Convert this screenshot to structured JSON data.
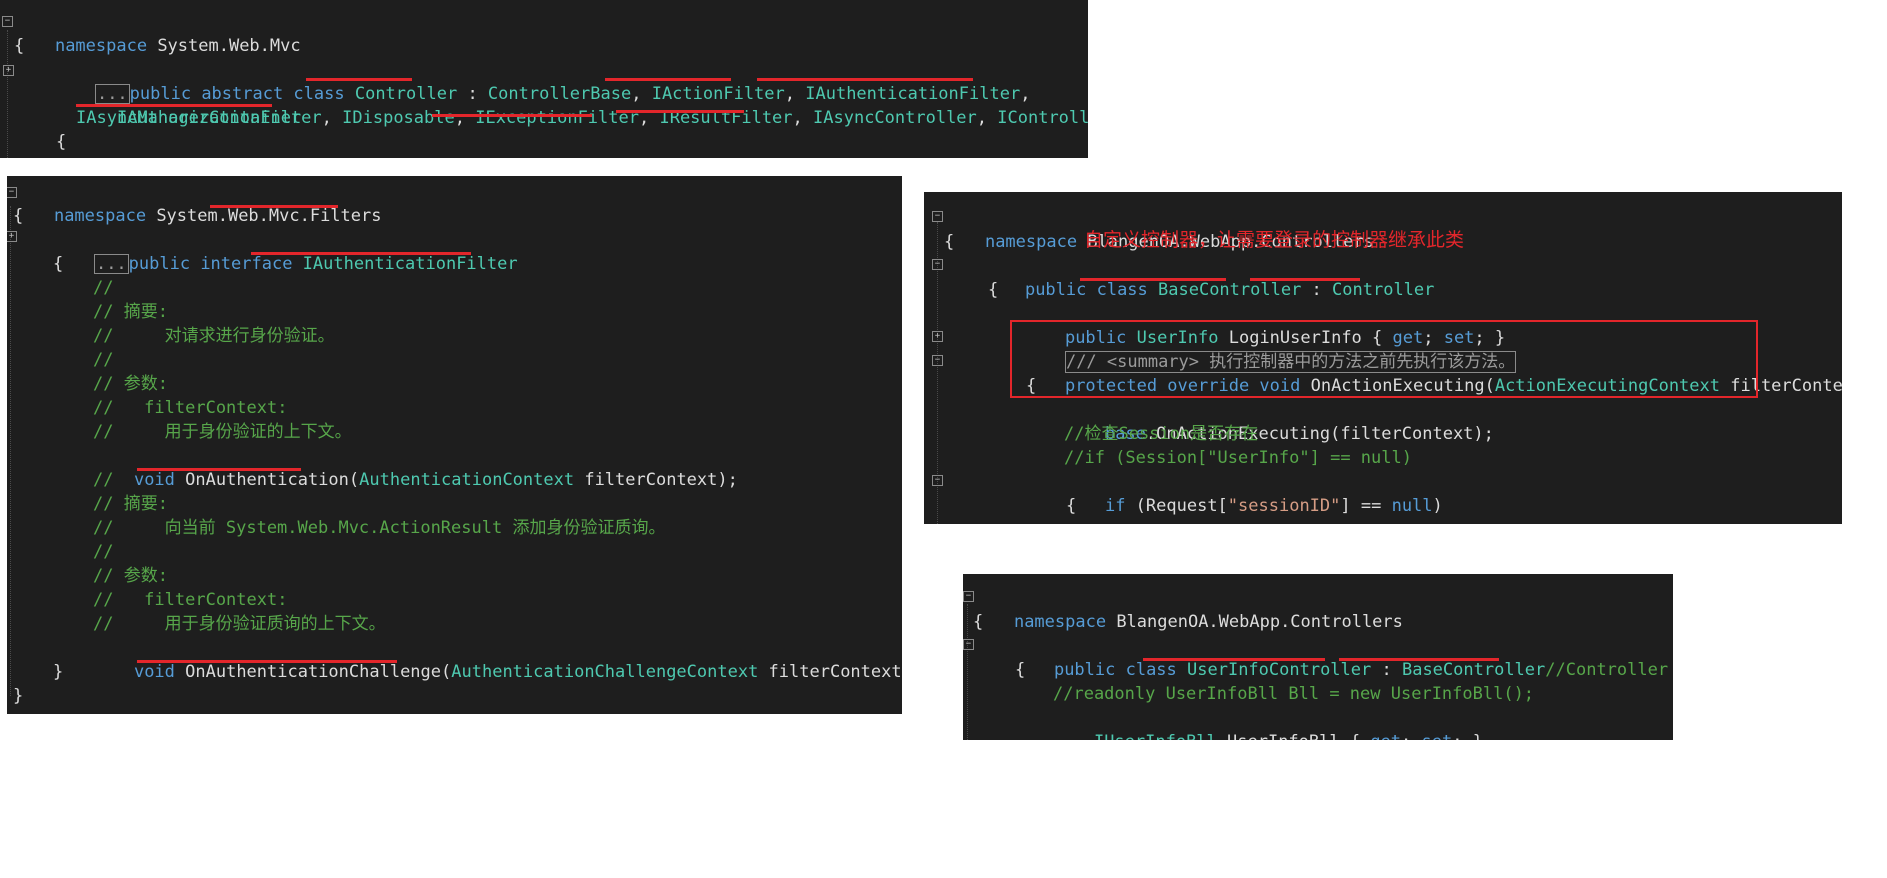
{
  "panel1": {
    "line1": "namespace System.Web.Mvc",
    "line2": "{",
    "ellipsis": "...",
    "line3_public": "public abstract class ",
    "line3_controller": "Controller",
    "line3_sep": " : ",
    "line3_base": "ControllerBase",
    "line3_rest1": ", ",
    "line3_iaction": "IActionFilter",
    "line3_rest2": ", ",
    "line3_iauthn": "IAuthenticationFilter",
    "line3_rest3": ",",
    "line4_iauthz": "IAuthorizationFilter",
    "line4_rest1": ", ",
    "line4_idisp": "IDisposable",
    "line4_rest2": ", ",
    "line4_iexc": "IExceptionFilter",
    "line4_rest3": ", ",
    "line4_iresult": "IResultFilter",
    "line4_rest4": ", ",
    "line4_iasync": "IAsyncController",
    "line4_rest5": ", ",
    "line4_icontroller": "IController",
    "line4_rest6": ",",
    "line5": "IAsyncManagerContainer",
    "line6": "{"
  },
  "panel2": {
    "line1_ns": "namespace",
    "line1_name": " System.Web.Mvc.Filters",
    "line2": "{",
    "ellipsis": "...",
    "line3_kw": "public interface ",
    "line3_name": "IAuthenticationFilter",
    "line4": "{",
    "c1": "//",
    "c2": "// 摘要:",
    "c3": "//     对请求进行身份验证。",
    "c4": "//",
    "c5": "// 参数:",
    "c6": "//   filterContext:",
    "c7": "//     用于身份验证的上下文。",
    "m1_void": "void ",
    "m1_name": "OnAuthentication",
    "m1_open": "(",
    "m1_type": "AuthenticationContext",
    "m1_rest": " filterContext);",
    "c8": "//",
    "c9": "// 摘要:",
    "c10": "//     向当前 System.Web.Mvc.ActionResult 添加身份验证质询。",
    "c11": "//",
    "c12": "// 参数:",
    "c13": "//   filterContext:",
    "c14": "//     用于身份验证质询的上下文。",
    "m2_void": "void ",
    "m2_name": "OnAuthenticationChallenge",
    "m2_open": "(",
    "m2_type": "AuthenticationChallengeContext",
    "m2_rest": " filterContext);",
    "close1": "}",
    "close2": "}"
  },
  "panel3": {
    "line1_ns": "namespace",
    "line1_name": " BlangenOA.WebApp.Controllers",
    "line2": "{",
    "annotation": "自定义控制器，让需要登录的控制器继承此类",
    "line3_kw": "public class ",
    "line3_name": "BaseController",
    "line3_sep": " : ",
    "line3_base": "Controller",
    "line4": "{",
    "line5_kw": "public ",
    "line5_type": "UserInfo",
    "line5_rest": " LoginUserInfo { ",
    "line5_get": "get",
    "line5_semi": "; ",
    "line5_set": "set",
    "line5_end": "; }",
    "line6": "/// <summary> 执行控制器中的方法之前先执行该方法。",
    "line7_kw": "protected override void ",
    "line7_name": "OnActionExecuting(",
    "line7_type": "ActionExecutingContext",
    "line7_rest": " filterContext)",
    "line8": "{",
    "line9_base": "base",
    "line9_rest": ".OnActionExecuting(filterContext);",
    "line10": "//检查Session是否存在",
    "line11": "//if (Session[\"UserInfo\"] == null)",
    "line12_if": "if",
    "line12_mid": " (Request[",
    "line12_str": "\"sessionID\"",
    "line12_eq": "] == ",
    "line12_null": "null",
    "line12_end": ")",
    "line13": "{"
  },
  "panel4": {
    "line1_ns": "namespace",
    "line1_name": " BlangenOA.WebApp.Controllers",
    "line2": "{",
    "line3_kw": "public class ",
    "line3_name": "UserInfoController",
    "line3_sep": " : ",
    "line3_base": "BaseController",
    "line3_comment": "//Controller",
    "line4": "{",
    "line5": "//readonly UserInfoBll Bll = new UserInfoBll();",
    "line6_type": "IUserInfoBll",
    "line6_rest": " UserInfoBll { ",
    "line6_get": "get",
    "line6_semi": "; ",
    "line6_set": "set",
    "line6_end": "; }"
  },
  "colors": {
    "editor_bg": "#1e1e1e",
    "keyword": "#569cd6",
    "type": "#4ec9b0",
    "comment": "#57a64a",
    "annotation_red": "#e3262b"
  }
}
